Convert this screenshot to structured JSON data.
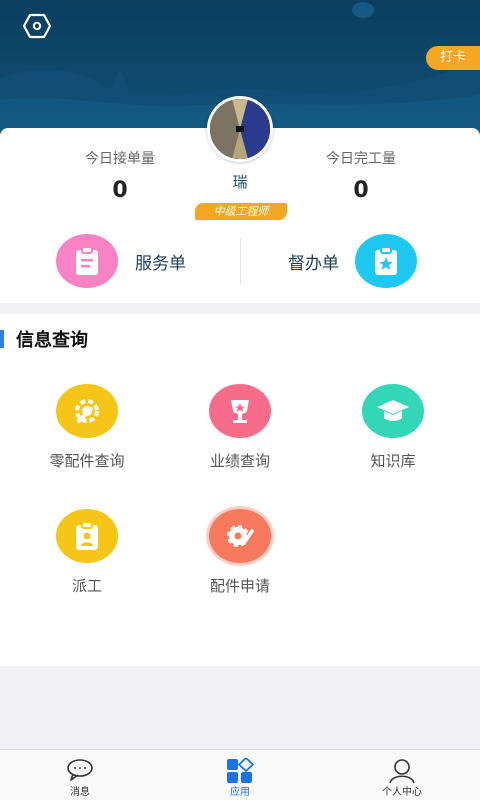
{
  "header": {
    "clock_in_label": "打卡",
    "settings_icon": "hexagon-settings-icon"
  },
  "profile": {
    "name": "瑞",
    "level": "中级工程师",
    "stats": [
      {
        "label": "今日接单量",
        "value": "0"
      },
      {
        "label": "今日完工量",
        "value": "0"
      }
    ]
  },
  "orders": {
    "service": {
      "label": "服务单",
      "icon": "clipboard-icon",
      "color": "#f783c4"
    },
    "supervise": {
      "label": "督办单",
      "icon": "clipboard-star-icon",
      "color": "#1ec8f0"
    }
  },
  "info": {
    "title": "信息查询",
    "items": [
      {
        "label": "零配件查询",
        "icon": "wrench-gear-icon",
        "color": "#f5c518"
      },
      {
        "label": "业绩查询",
        "icon": "trophy-icon",
        "color": "#f76c8b"
      },
      {
        "label": "知识库",
        "icon": "graduation-cap-icon",
        "color": "#34d6b8"
      },
      {
        "label": "派工",
        "icon": "clipboard-person-icon",
        "color": "#f5c518"
      },
      {
        "label": "配件申请",
        "icon": "gear-pen-icon",
        "color": "#f77a5e"
      }
    ]
  },
  "nav": {
    "items": [
      {
        "label": "消息",
        "icon": "chat-bubble-icon"
      },
      {
        "label": "应用",
        "icon": "apps-grid-icon"
      },
      {
        "label": "个人中心",
        "icon": "person-icon"
      }
    ],
    "active_index": 1
  }
}
